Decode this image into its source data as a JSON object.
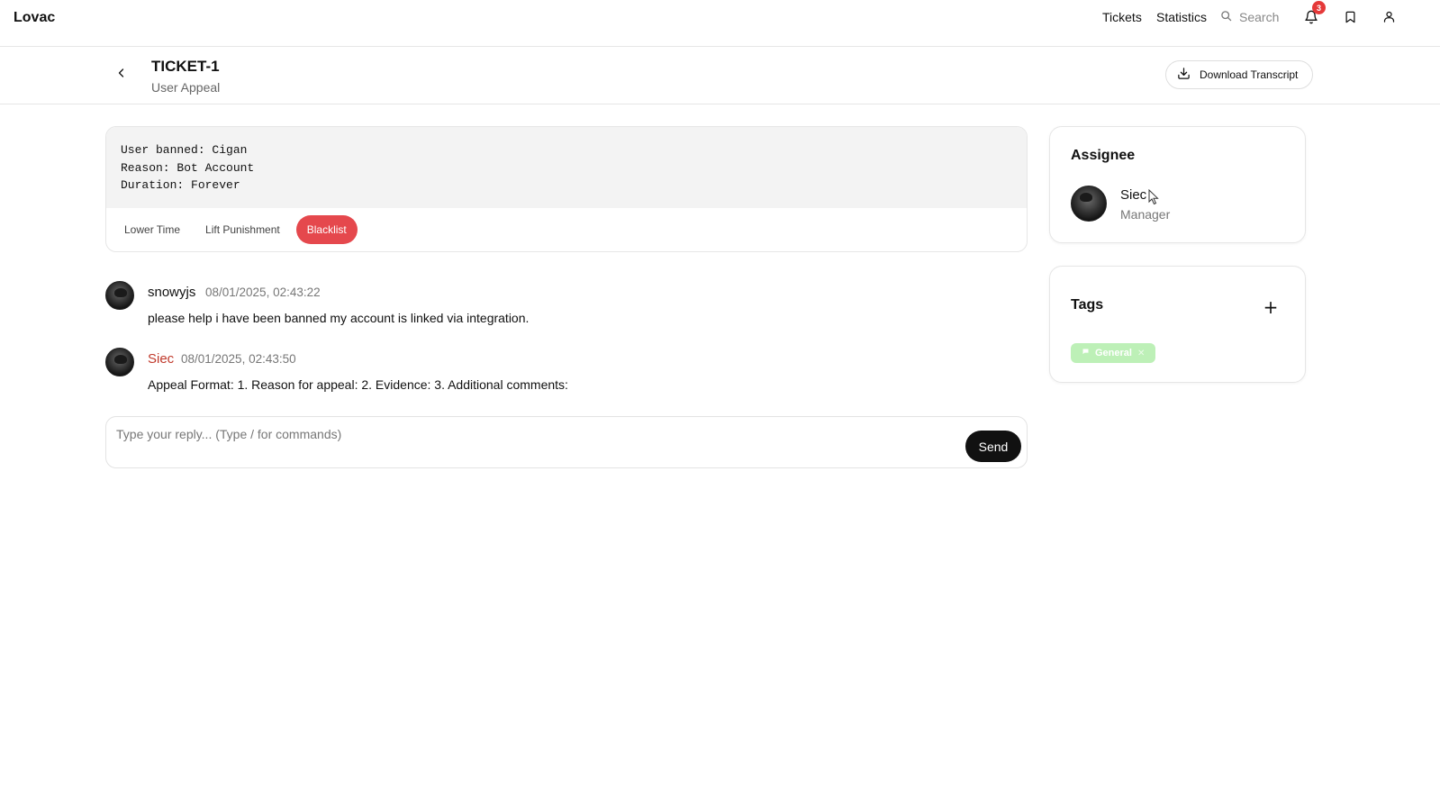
{
  "app": {
    "brand": "Lovac",
    "nav": [
      {
        "label": "Tickets"
      },
      {
        "label": "Statistics"
      }
    ],
    "search": {
      "placeholder": "Search",
      "icon": "search-icon"
    },
    "notifications": {
      "count": "3",
      "icon": "bell-icon"
    },
    "bookmark_icon": "bookmark-icon",
    "profile_icon": "user-icon"
  },
  "ticket": {
    "title": "TICKET-1",
    "category": "User Appeal",
    "download_label": "Download Transcript"
  },
  "punishment": {
    "lines": [
      "User banned: Cigan",
      "Reason: Bot Account",
      "Duration: Forever"
    ],
    "actions": [
      {
        "label": "Lower Time"
      },
      {
        "label": "Lift Punishment"
      },
      {
        "label": "Blacklist",
        "accent": "#e5484d"
      }
    ]
  },
  "messages": [
    {
      "author": "snowyjs",
      "timestamp": "08/01/2025, 02:43:22",
      "body": "please help i have been banned my account is linked via integration.",
      "staff": false
    },
    {
      "author": "Siec",
      "timestamp": "08/01/2025, 02:43:50",
      "body": "Appeal Format: 1. Reason for appeal: 2. Evidence: 3. Additional comments:",
      "staff": true,
      "author_color": "#c0392b"
    }
  ],
  "reply": {
    "placeholder": "Type your reply... (Type / for commands)",
    "send_label": "Send"
  },
  "assignee": {
    "title": "Assignee",
    "name": "Siec",
    "role": "Manager"
  },
  "tags": {
    "title": "Tags",
    "add_icon": "plus-icon",
    "items": [
      {
        "label": "General",
        "color": "#b6efb0"
      }
    ]
  }
}
